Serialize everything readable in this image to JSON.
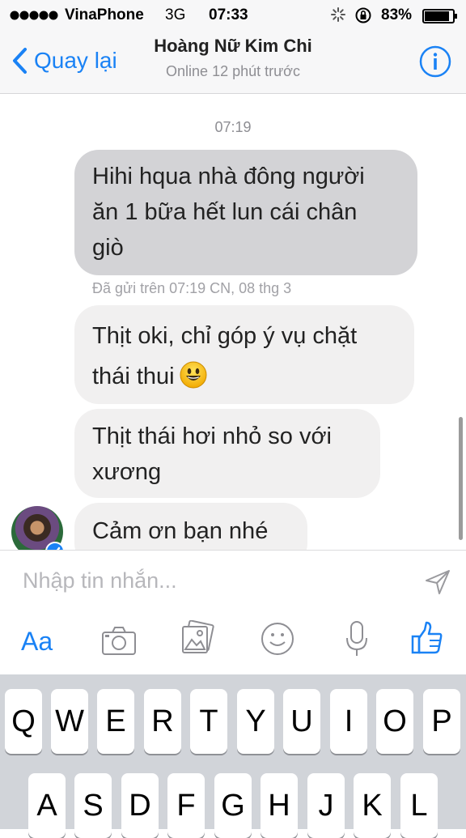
{
  "status_bar": {
    "carrier": "VinaPhone",
    "network": "3G",
    "time": "07:33",
    "battery": "83%"
  },
  "header": {
    "back_label": "Quay lại",
    "title": "Hoàng Nữ Kim Chi",
    "subtitle": "Online 12 phút trước"
  },
  "chat": {
    "timestamp": "07:19",
    "messages": [
      {
        "side": "sent",
        "lines": [
          "Hihi hqua nhà đông người",
          "ăn 1 bữa hết lun cái chân",
          "giò"
        ]
      },
      {
        "side": "received",
        "lines": [
          "Thịt oki, chỉ góp ý vụ chặt",
          "thái thui"
        ],
        "emoji": "smiley-icon"
      },
      {
        "side": "received",
        "lines": [
          "Thịt thái hơi nhỏ so với",
          "xương"
        ]
      },
      {
        "side": "received",
        "lines": [
          "Cảm ơn bạn nhé"
        ]
      }
    ],
    "delivered": "Đã gửi trên 07:19 CN, 08 thg 3"
  },
  "composer": {
    "placeholder": "Nhập tin nhắn...",
    "aa_label": "Aa"
  },
  "toolbar_icons": [
    "camera-icon",
    "photo-gallery-icon",
    "emoji-icon",
    "microphone-icon",
    "thumbs-up-icon"
  ],
  "keyboard": {
    "row1": [
      "Q",
      "W",
      "E",
      "R",
      "T",
      "Y",
      "U",
      "I",
      "O",
      "P"
    ],
    "row2": [
      "A",
      "S",
      "D",
      "F",
      "G",
      "H",
      "J",
      "K",
      "L"
    ]
  },
  "colors": {
    "accent": "#1a82f5",
    "sent_bubble": "#d3d3d6",
    "received_bubble": "#f1f0f0"
  }
}
